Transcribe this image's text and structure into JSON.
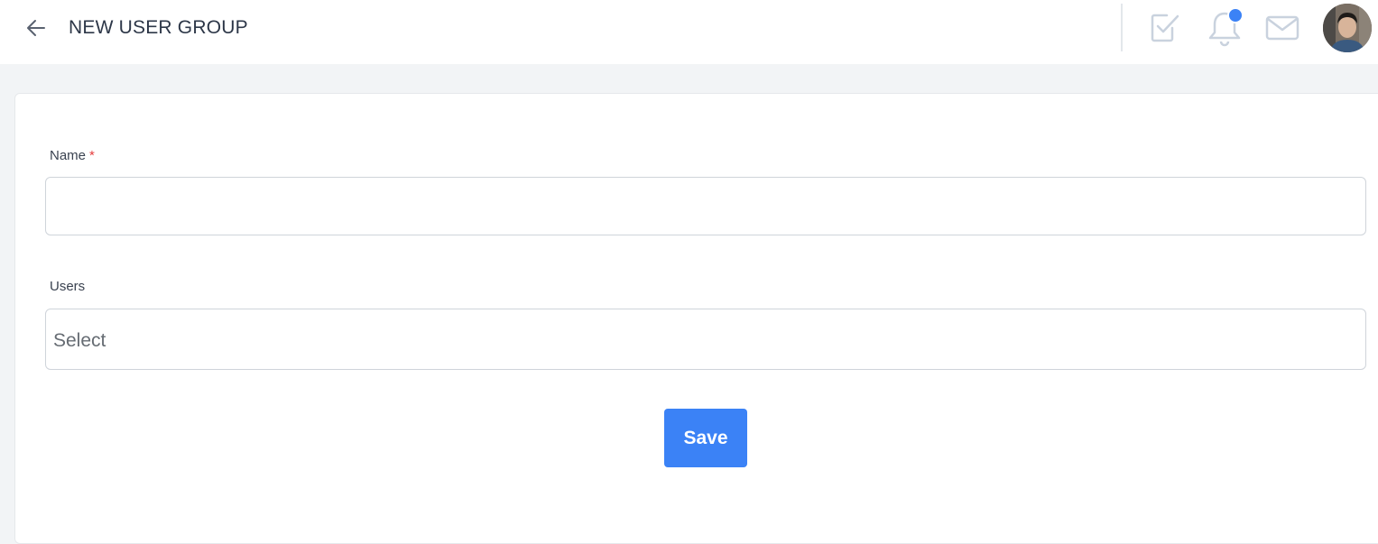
{
  "header": {
    "title": "NEW USER GROUP",
    "back_icon": "arrow-left-icon",
    "icons": [
      "check-square-icon",
      "bell-icon",
      "mail-icon"
    ],
    "notification_dot_color": "#3b82f6"
  },
  "form": {
    "name_label": "Name",
    "name_required_marker": "*",
    "name_value": "",
    "users_label": "Users",
    "users_placeholder": "Select",
    "save_label": "Save"
  },
  "colors": {
    "accent": "#3b82f6",
    "required": "#e53e3e",
    "background": "#f2f4f6"
  }
}
